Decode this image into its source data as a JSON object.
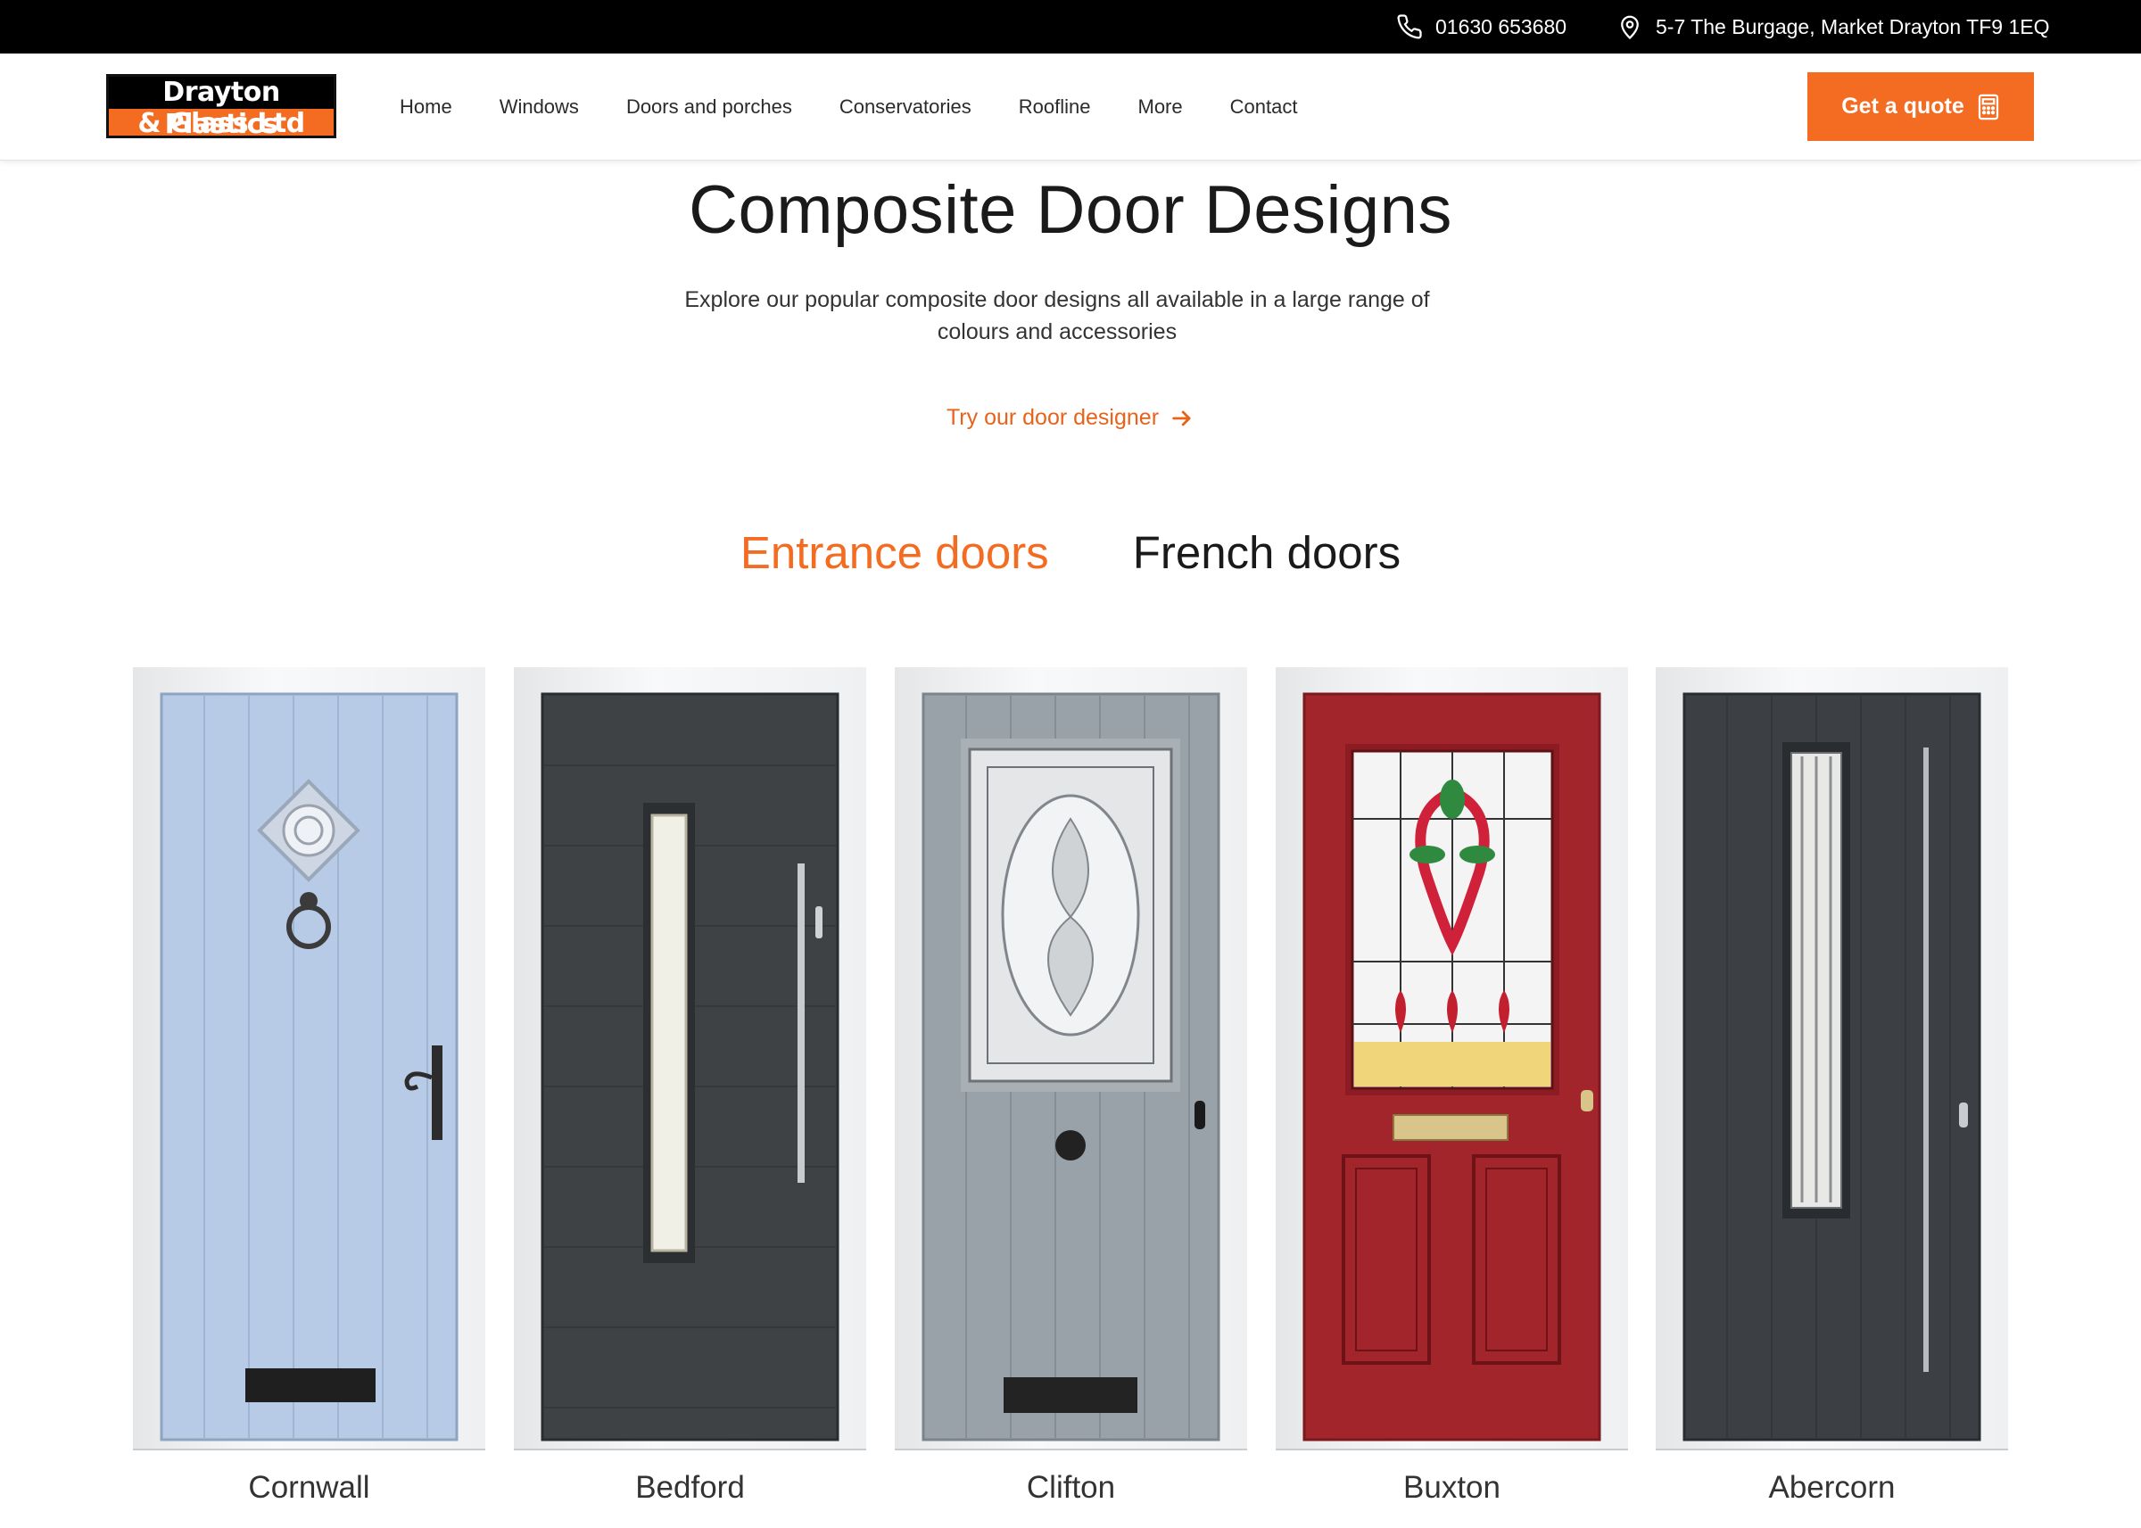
{
  "topbar": {
    "phone": "01630 653680",
    "address": "5-7 The Burgage, Market Drayton TF9 1EQ"
  },
  "header": {
    "logo_line1": "Drayton Plastics",
    "logo_line2": "& Glass Ltd",
    "nav": [
      "Home",
      "Windows",
      "Doors and porches",
      "Conservatories",
      "Roofline",
      "More",
      "Contact"
    ],
    "cta": "Get a quote"
  },
  "hero": {
    "title": "Composite Door Designs",
    "subtitle": "Explore our popular composite door designs all available in a large range of colours and accessories",
    "designer_link": "Try our door designer"
  },
  "tabs": [
    {
      "label": "Entrance doors",
      "active": true
    },
    {
      "label": "French doors",
      "active": false
    }
  ],
  "doors": [
    {
      "name": "Cornwall",
      "color": "#b7cbe6"
    },
    {
      "name": "Bedford",
      "color": "#3e4245"
    },
    {
      "name": "Clifton",
      "color": "#9aa2a9"
    },
    {
      "name": "Buxton",
      "color": "#a1252b"
    },
    {
      "name": "Abercorn",
      "color": "#3c4045"
    }
  ],
  "colors": {
    "accent": "#f36c21",
    "topbar": "#000000"
  }
}
